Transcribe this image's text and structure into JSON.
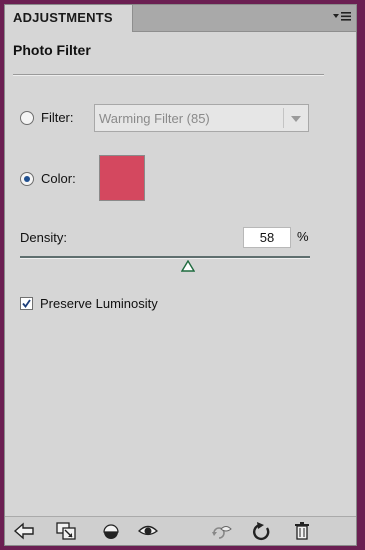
{
  "tab": {
    "label": "ADJUSTMENTS"
  },
  "panel": {
    "title": "Photo Filter"
  },
  "filter": {
    "label": "Filter:",
    "selected": "Warming Filter (85)",
    "checked": false
  },
  "color": {
    "label": "Color:",
    "checked": true,
    "swatch_hex": "#d4485f"
  },
  "density": {
    "label": "Density:",
    "value": "58",
    "unit": "%",
    "level_percent": 58
  },
  "preserve": {
    "label": "Preserve Luminosity",
    "checked": true
  },
  "icons": {
    "menu": "panel-menu-icon",
    "back": "back-arrow-icon",
    "expand": "expand-view-icon",
    "clip": "clip-to-layer-icon",
    "visibility": "eye-icon",
    "view_previous": "view-previous-icon",
    "reset": "reset-icon",
    "delete": "trash-icon"
  },
  "colors": {
    "background": "#6b1f52",
    "panel": "#d6d6d6",
    "radio_dot": "#1f4f8f"
  }
}
